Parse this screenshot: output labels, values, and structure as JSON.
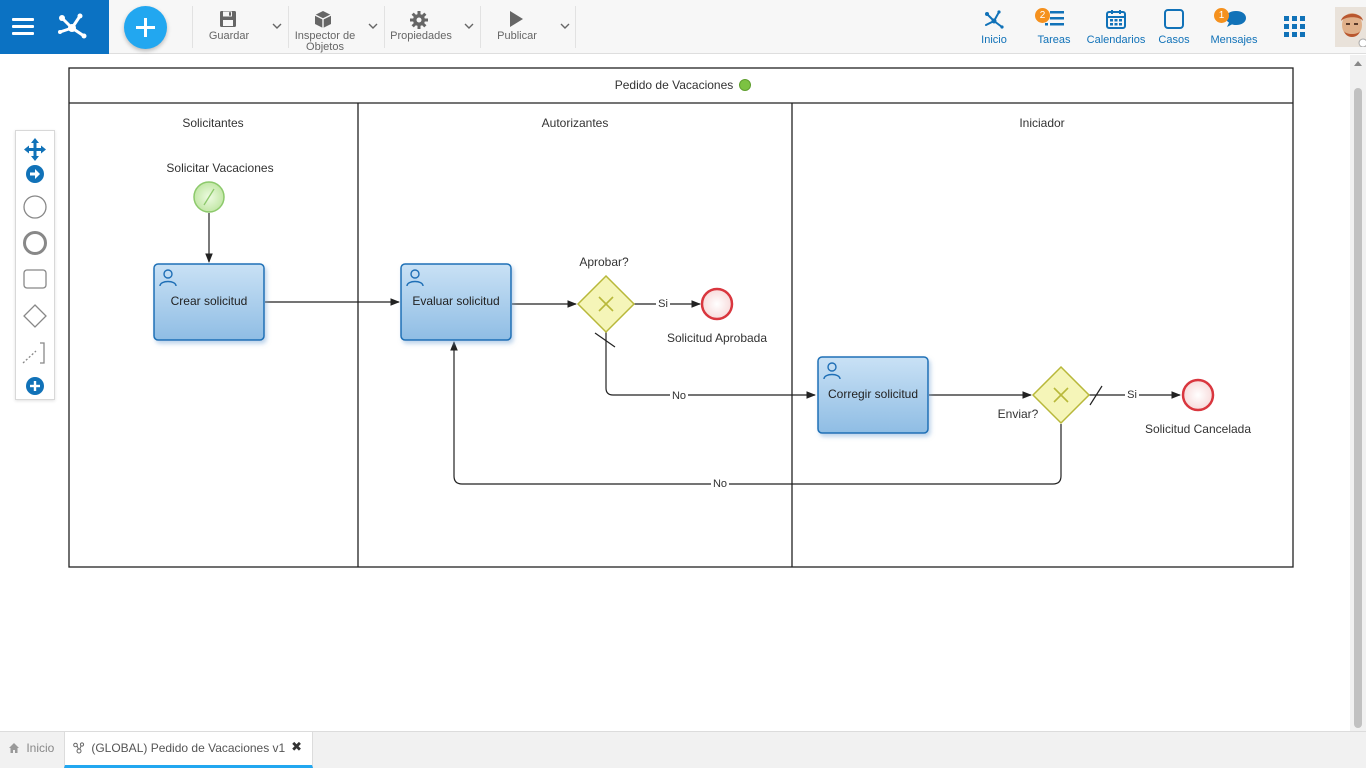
{
  "header": {
    "toolbar": {
      "save_label": "Guardar",
      "inspector_label_line1": "Inspector de",
      "inspector_label_line2": "Objetos",
      "properties_label": "Propiedades",
      "publish_label": "Publicar"
    },
    "nav": {
      "home_label": "Inicio",
      "tasks_label": "Tareas",
      "tasks_badge": "2",
      "calendars_label": "Calendarios",
      "cases_label": "Casos",
      "messages_label": "Mensajes",
      "messages_badge": "1"
    }
  },
  "diagram": {
    "pool_title": "Pedido de Vacaciones",
    "lanes": [
      "Solicitantes",
      "Autorizantes",
      "Iniciador"
    ],
    "start_event_label": "Solicitar Vacaciones",
    "tasks": {
      "create": "Crear solicitud",
      "evaluate": "Evaluar solicitud",
      "correct": "Corregir solicitud"
    },
    "gateways": {
      "approve": "Aprobar?",
      "send": "Enviar?"
    },
    "end_events": {
      "approved": "Solicitud Aprobada",
      "cancelled": "Solicitud Cancelada"
    },
    "flow_labels": {
      "approve_yes": "Si",
      "approve_no": "No",
      "send_yes": "Si",
      "send_no": "No"
    },
    "colors": {
      "task_fill": "#a9cdeb",
      "task_stroke": "#1f6fb6",
      "gateway_fill": "#f5f5b8",
      "gateway_stroke": "#b8b83a",
      "start_fill": "#cfeeb8",
      "end_stroke": "#d9363e",
      "status_dot": "#7cc242"
    }
  },
  "tabs": {
    "home_label": "Inicio",
    "active_label": "(GLOBAL) Pedido de Vacaciones v1",
    "close_symbol": "✖"
  }
}
